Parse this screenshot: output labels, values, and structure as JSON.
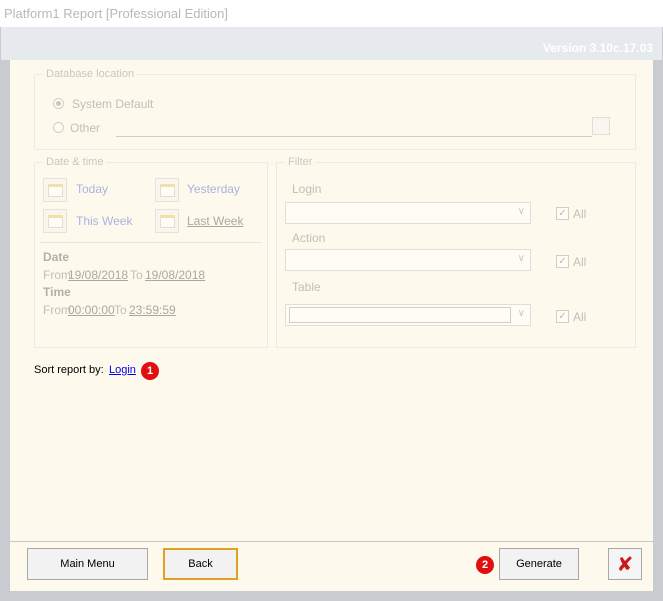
{
  "window": {
    "title": "Platform1 Report [Professional Edition]"
  },
  "header": {
    "version": "Version 3.10c.17.03"
  },
  "database_location": {
    "legend": "Database location",
    "options": [
      {
        "label": "System Default",
        "selected": true
      },
      {
        "label": "Other",
        "selected": false
      }
    ]
  },
  "date_time": {
    "legend": "Date & time",
    "today": "Today",
    "yesterday": "Yesterday",
    "this_week": "This Week",
    "last_week": "Last Week",
    "date_heading": "Date",
    "date_from_label": "From",
    "date_from": "19/08/2018",
    "date_to_label": "To",
    "date_to": "19/08/2018",
    "time_heading": "Time",
    "time_from_label": "From",
    "time_from": "00:00:00",
    "time_to_label": "To",
    "time_to": "23:59:59"
  },
  "filter": {
    "legend": "Filter",
    "login_label": "Login",
    "action_label": "Action",
    "table_label": "Table",
    "all_label": "All",
    "all_login": true,
    "all_action": true,
    "all_table": true
  },
  "sort": {
    "label": "Sort report by:",
    "value": "Login",
    "badge": "1"
  },
  "footer": {
    "main_menu": "Main Menu",
    "back": "Back",
    "generate": "Generate",
    "generate_badge": "2",
    "close_glyph": "✘"
  },
  "colors": {
    "badge": "#e01010",
    "close": "#cc1a1a",
    "panel": "#fdf9ec",
    "focus_border": "#e0a020"
  }
}
